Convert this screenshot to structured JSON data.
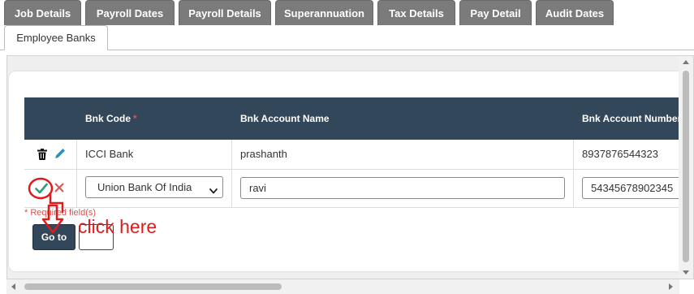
{
  "tabs": [
    {
      "label": "Job Details"
    },
    {
      "label": "Payroll Dates"
    },
    {
      "label": "Payroll Details"
    },
    {
      "label": "Superannuation"
    },
    {
      "label": "Tax Details"
    },
    {
      "label": "Pay Detail"
    },
    {
      "label": "Audit Dates"
    }
  ],
  "active_tab": {
    "label": "Employee Banks"
  },
  "table": {
    "headers": {
      "bank_code": "Bnk Code",
      "required_marker": "*",
      "account_name": "Bnk Account Name",
      "account_number": "Bnk Account Number"
    },
    "rows": [
      {
        "bank_code": "ICCI Bank",
        "account_name": "prashanth",
        "account_number": "8937876544323"
      }
    ],
    "edit_row": {
      "bank_code_selected": "Union Bank Of India",
      "account_name_value": "ravi",
      "account_number_value": "54345678902345"
    }
  },
  "required_note": "* Required field(s)",
  "buttons": {
    "goto_label": "Go to"
  },
  "annotation": {
    "text": "click here"
  },
  "colors": {
    "tab_bg": "#7b7b7b",
    "header_bg": "#33475b",
    "edit_icon": "#2e8fb5",
    "save_icon": "#2aa07a",
    "cancel_icon": "#d9534f",
    "annotation": "#e01b1b"
  }
}
